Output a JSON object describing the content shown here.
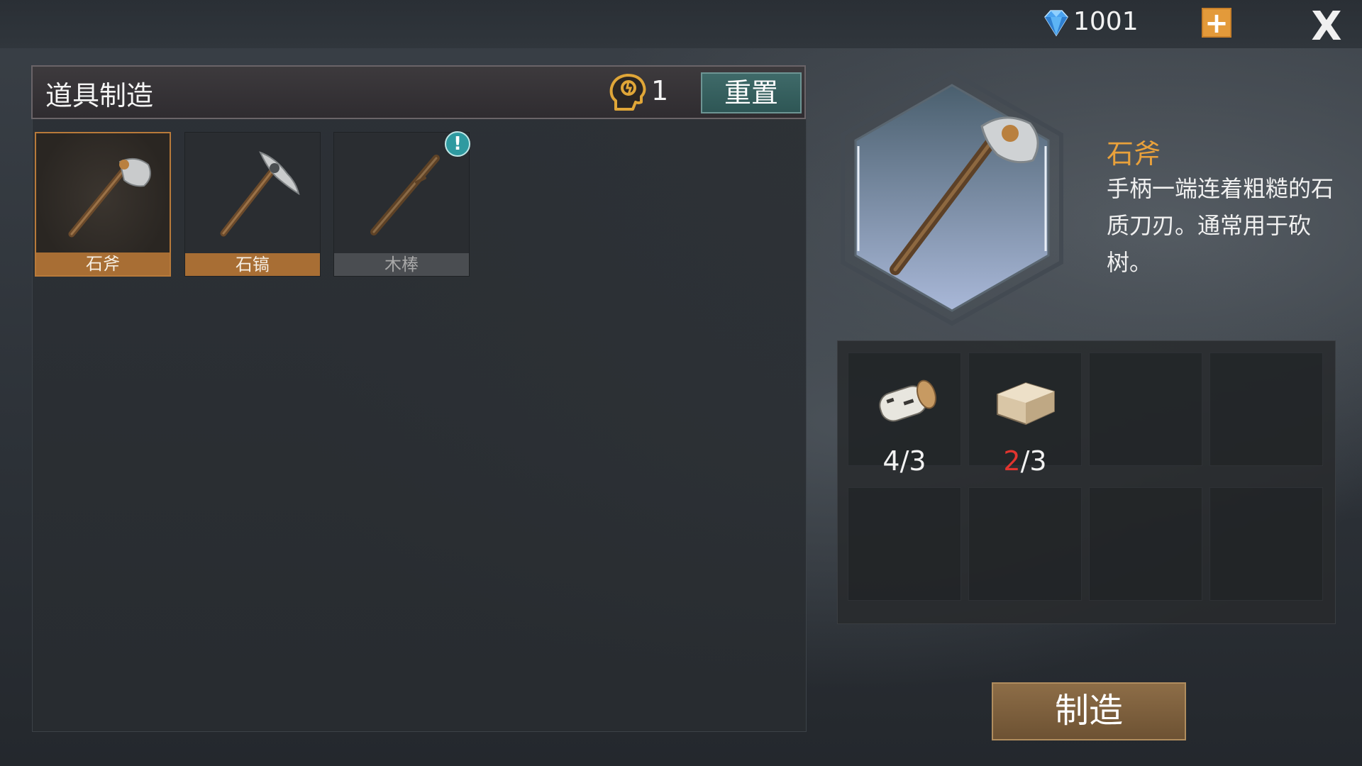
{
  "topbar": {
    "gem_count": "1001",
    "plus_label": "+",
    "close_label": "X"
  },
  "panel": {
    "title": "道具制造",
    "points": "1",
    "reset_label": "重置"
  },
  "items": [
    {
      "label": "石斧",
      "state": "selected",
      "icon": "stone-axe-icon"
    },
    {
      "label": "石镐",
      "state": "available",
      "icon": "stone-pickaxe-icon"
    },
    {
      "label": "木棒",
      "state": "locked",
      "icon": "wooden-stick-icon",
      "badge": "!"
    }
  ],
  "detail": {
    "name": "石斧",
    "description": "手柄一端连着粗糙的石质刀刃。通常用于砍树。"
  },
  "materials": [
    {
      "icon": "birch-log-icon",
      "have": "4",
      "sep": "/",
      "need": "3",
      "short": false
    },
    {
      "icon": "stone-block-icon",
      "have": "2",
      "sep": "/",
      "need": "3",
      "short": true
    }
  ],
  "craft_label": "制造",
  "colors": {
    "accent": "#e9a13b",
    "selected_label": "#a86e34",
    "reset": "#3f6a69",
    "shortage": "#e2352f"
  }
}
